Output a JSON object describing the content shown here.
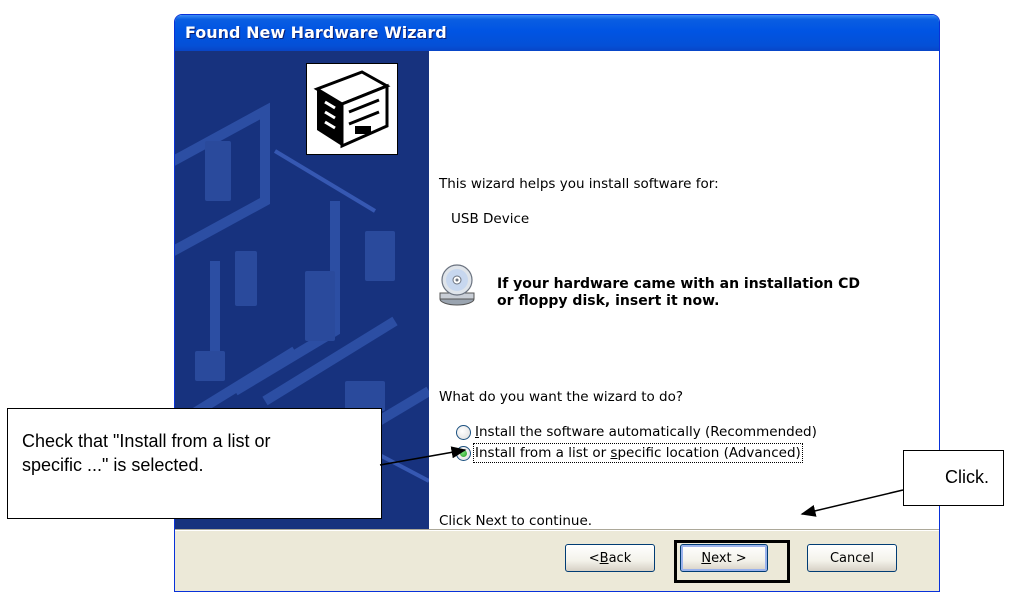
{
  "window": {
    "title": "Found New Hardware Wizard"
  },
  "content": {
    "intro": "This wizard helps you install software for:",
    "device_name": "USB Device",
    "cd_prompt_line1": "If your hardware came with an installation CD",
    "cd_prompt_line2": "or floppy disk, insert it now.",
    "question": "What do you want the wizard to do?",
    "options": [
      {
        "label_pre": "",
        "label_key": "I",
        "label_post": "nstall the software automatically (Recommended)",
        "selected": false
      },
      {
        "label_pre": "Install from a list or ",
        "label_key": "s",
        "label_post": "pecific location (Advanced)",
        "selected": true
      }
    ],
    "continue_hint": "Click Next to continue."
  },
  "buttons": {
    "back_pre": "< ",
    "back_key": "B",
    "back_post": "ack",
    "next_key": "N",
    "next_post": "ext >",
    "cancel": "Cancel"
  },
  "callouts": {
    "left_line1": "Check that \"Install from a list or",
    "left_line2": "specific ...\" is selected.",
    "right": "Click."
  },
  "colors": {
    "title_bar": "#0054e3",
    "art_panel": "#17327e",
    "dialog_face": "#ece9d8",
    "radio_selected": "#1e9c1e"
  },
  "icons": {
    "hardware": "hardware-card-icon",
    "cd": "cd-drive-icon"
  }
}
